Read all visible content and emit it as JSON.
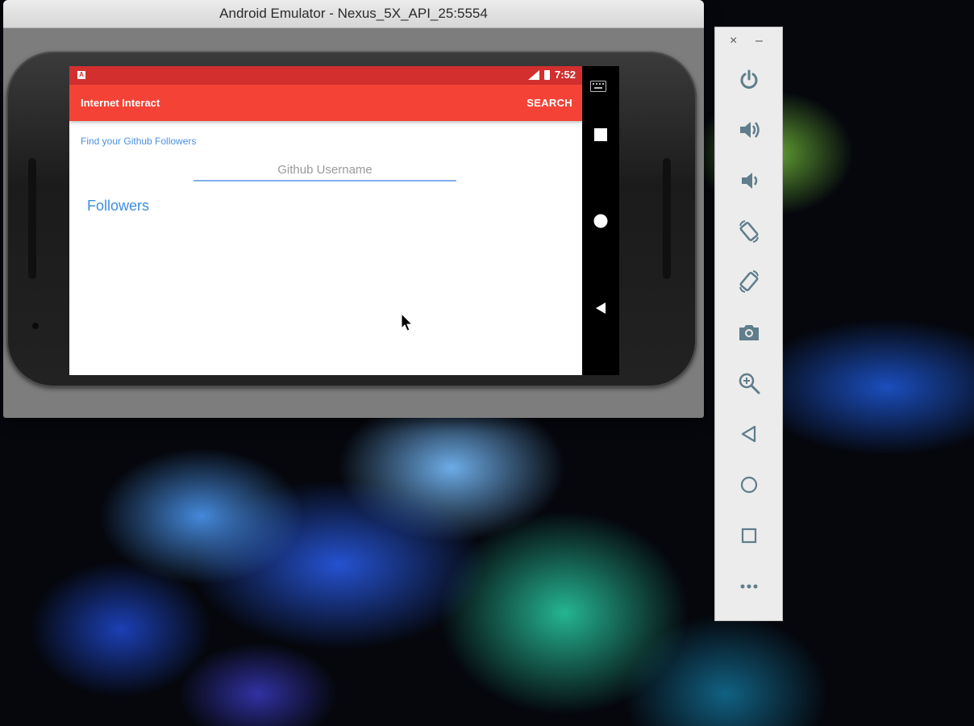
{
  "window": {
    "title": "Android Emulator - Nexus_5X_API_25:5554"
  },
  "status_bar": {
    "notification_icon": "A",
    "time": "7:52"
  },
  "app_bar": {
    "title": "Internet Interact",
    "action": "SEARCH"
  },
  "content": {
    "find_label": "Find your Github Followers",
    "username_placeholder": "Github Username",
    "username_value": "",
    "followers_label": "Followers"
  },
  "nav_bar": {
    "icons": [
      "keyboard-icon",
      "recents-icon",
      "home-icon",
      "back-icon"
    ]
  },
  "toolbar": {
    "close": "×",
    "minimize": "–",
    "buttons": [
      "power-icon",
      "volume-up-icon",
      "volume-down-icon",
      "rotate-left-icon",
      "rotate-right-icon",
      "camera-icon",
      "zoom-icon",
      "back-icon",
      "home-icon",
      "overview-icon",
      "more-icon"
    ]
  },
  "colors": {
    "status_bar": "#d32f2f",
    "app_bar": "#f44336",
    "accent_blue": "#3d8ee0",
    "toolbar_icon": "#607d8b"
  }
}
